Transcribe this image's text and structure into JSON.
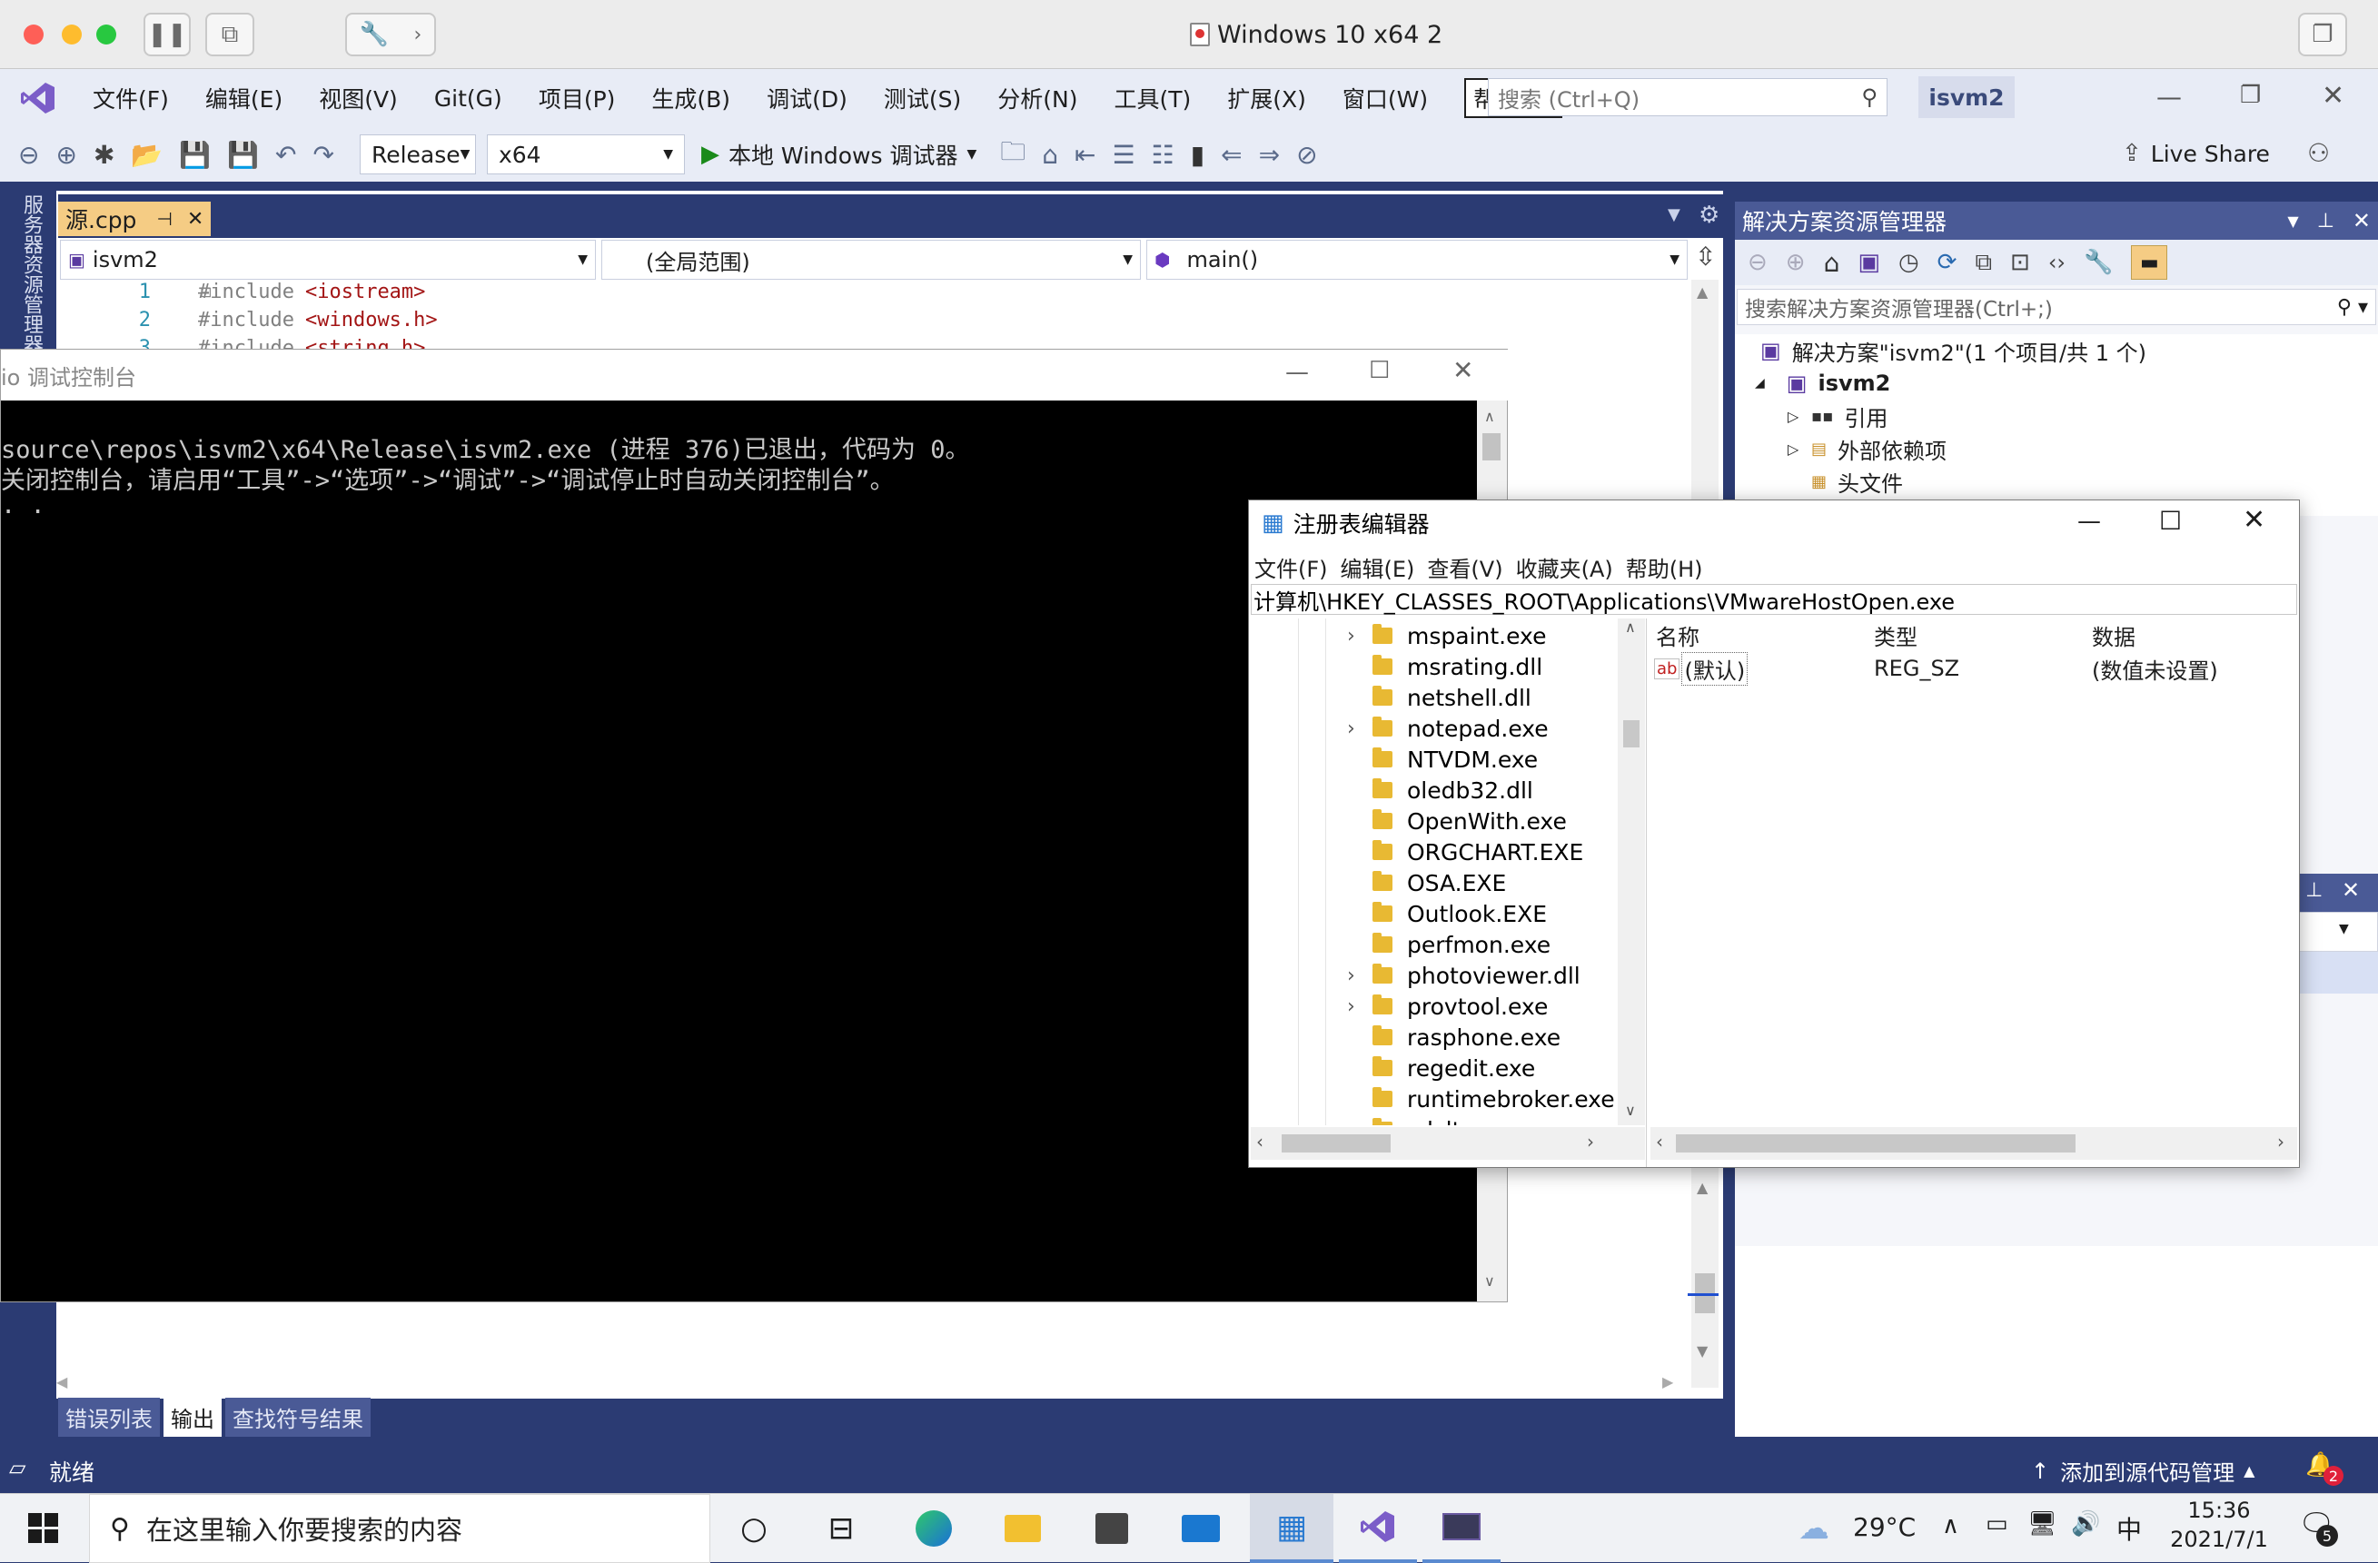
{
  "mac": {
    "window_title": "Windows 10 x64 2"
  },
  "vs": {
    "menu": [
      "文件(F)",
      "编辑(E)",
      "视图(V)",
      "Git(G)",
      "项目(P)",
      "生成(B)",
      "调试(D)",
      "测试(S)",
      "分析(N)",
      "工具(T)",
      "扩展(X)",
      "窗口(W)",
      "帮助(H)"
    ],
    "search_placeholder": "搜索 (Ctrl+Q)",
    "solution_name": "isvm2",
    "toolbar": {
      "config": "Release",
      "platform": "x64",
      "debugger": "本地 Windows 调试器",
      "live_share": "Live Share"
    },
    "side_tab": "服务器资源管理器",
    "editor": {
      "tab": "源.cpp",
      "project_combo": "isvm2",
      "scope_combo": "(全局范围)",
      "member_combo": "main()",
      "lines": [
        {
          "num": "1",
          "kw": "#include",
          "inc": "<iostream>"
        },
        {
          "num": "2",
          "kw": "#include",
          "inc": "<windows.h>"
        },
        {
          "num": "3",
          "kw": "#include",
          "inc": "<string.h>"
        }
      ]
    },
    "bottom_tabs": [
      "错误列表",
      "输出",
      "查找符号结果"
    ],
    "status": {
      "ready": "就绪",
      "source_control": "添加到源代码管理",
      "notifications": "2"
    }
  },
  "console": {
    "title": "io 调试控制台",
    "lines": [
      "source\\repos\\isvm2\\x64\\Release\\isvm2.exe (进程 376)已退出，代码为 0。",
      "关闭控制台，请启用“工具”->“选项”->“调试”->“调试停止时自动关闭控制台”。",
      " . ."
    ]
  },
  "regedit": {
    "title": "注册表编辑器",
    "menu": [
      "文件(F)",
      "编辑(E)",
      "查看(V)",
      "收藏夹(A)",
      "帮助(H)"
    ],
    "address": "计算机\\HKEY_CLASSES_ROOT\\Applications\\VMwareHostOpen.exe",
    "tree": [
      {
        "name": "mspaint.exe",
        "expandable": true
      },
      {
        "name": "msrating.dll",
        "expandable": false
      },
      {
        "name": "netshell.dll",
        "expandable": false
      },
      {
        "name": "notepad.exe",
        "expandable": true
      },
      {
        "name": "NTVDM.exe",
        "expandable": false
      },
      {
        "name": "oledb32.dll",
        "expandable": false
      },
      {
        "name": "OpenWith.exe",
        "expandable": false
      },
      {
        "name": "ORGCHART.EXE",
        "expandable": false
      },
      {
        "name": "OSA.EXE",
        "expandable": false
      },
      {
        "name": "Outlook.EXE",
        "expandable": false
      },
      {
        "name": "perfmon.exe",
        "expandable": false
      },
      {
        "name": "photoviewer.dll",
        "expandable": true
      },
      {
        "name": "provtool.exe",
        "expandable": true
      },
      {
        "name": "rasphone.exe",
        "expandable": false
      },
      {
        "name": "regedit.exe",
        "expandable": false
      },
      {
        "name": "runtimebroker.exe",
        "expandable": false
      },
      {
        "name": "sdclt.exe",
        "expandable": false
      }
    ],
    "columns": [
      "名称",
      "类型",
      "数据"
    ],
    "values": [
      {
        "name": "(默认)",
        "type": "REG_SZ",
        "data": "(数值未设置)"
      }
    ]
  },
  "solution_explorer": {
    "title": "解决方案资源管理器",
    "search_placeholder": "搜索解决方案资源管理器(Ctrl+;)",
    "solution_label": "解决方案\"isvm2\"(1 个项目/共 1 个)",
    "project": "isvm2",
    "items": [
      "引用",
      "外部依赖项",
      "头文件"
    ]
  },
  "taskbar": {
    "search_placeholder": "在这里输入你要搜索的内容",
    "weather": "29°C",
    "ime": "中",
    "time": "15:36",
    "date": "2021/7/1",
    "notif_count": "5"
  }
}
